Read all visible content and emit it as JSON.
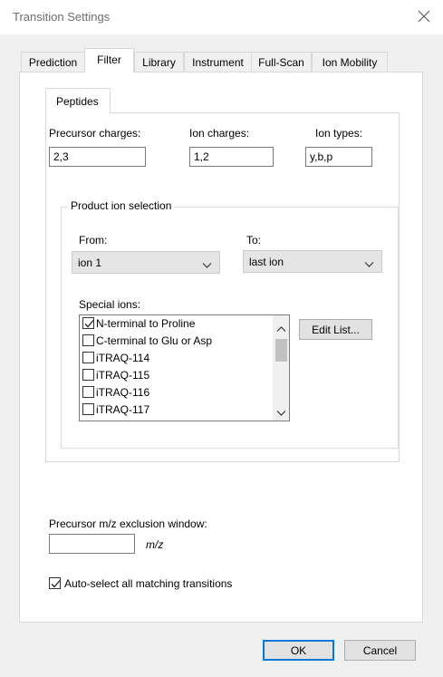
{
  "window": {
    "title": "Transition Settings",
    "close_icon": "close-icon"
  },
  "tabs": [
    {
      "label": "Prediction"
    },
    {
      "label": "Filter",
      "active": true
    },
    {
      "label": "Library"
    },
    {
      "label": "Instrument"
    },
    {
      "label": "Full-Scan"
    },
    {
      "label": "Ion Mobility"
    }
  ],
  "inner_tab": {
    "label": "Peptides"
  },
  "peptides": {
    "precursor_charges": {
      "label": "Precursor charges:",
      "value": "2,3"
    },
    "ion_charges": {
      "label": "Ion charges:",
      "value": "1,2"
    },
    "ion_types": {
      "label": "Ion types:",
      "value": "y,b,p"
    }
  },
  "product_ion_selection": {
    "label": "Product ion selection",
    "from": {
      "label": "From:",
      "value": "ion 1"
    },
    "to": {
      "label": "To:",
      "value": "last ion"
    },
    "special_ions": {
      "label": "Special ions:",
      "items": [
        {
          "label": "N-terminal to Proline",
          "checked": true
        },
        {
          "label": "C-terminal to Glu or Asp",
          "checked": false
        },
        {
          "label": "iTRAQ-114",
          "checked": false
        },
        {
          "label": "iTRAQ-115",
          "checked": false
        },
        {
          "label": "iTRAQ-116",
          "checked": false
        },
        {
          "label": "iTRAQ-117",
          "checked": false
        }
      ]
    },
    "edit_list_label": "Edit List..."
  },
  "exclusion": {
    "label": "Precursor m/z exclusion window:",
    "value": "",
    "unit": "m/z"
  },
  "auto_select": {
    "label": "Auto-select all matching transitions",
    "checked": true
  },
  "buttons": {
    "ok": "OK",
    "cancel": "Cancel"
  },
  "colors": {
    "accent": "#0078d7",
    "border": "#d9d9d9"
  }
}
